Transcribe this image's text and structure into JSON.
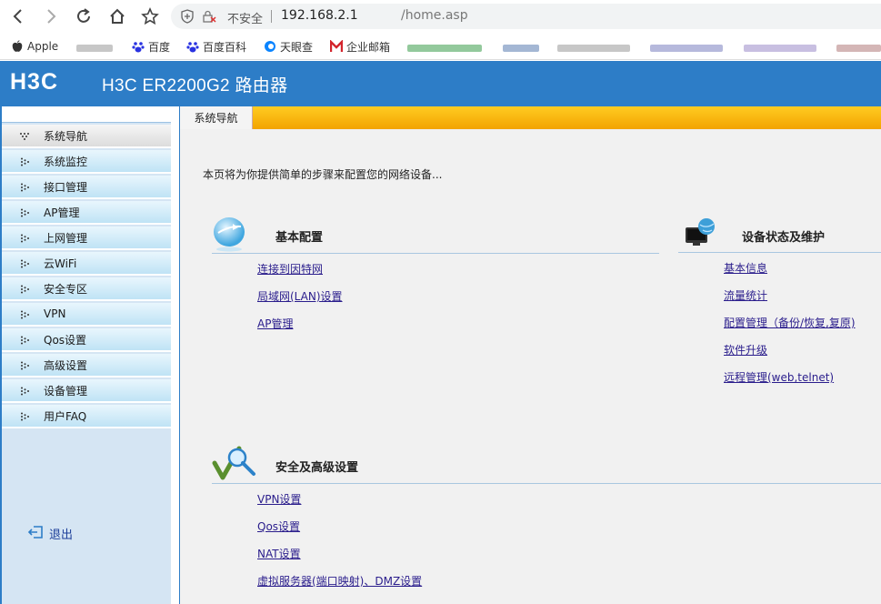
{
  "browser": {
    "security_label": "不安全",
    "url_host": "192.168.2.1",
    "url_path": "/home.asp",
    "bookmarks": [
      "Apple",
      "百度",
      "百度百科",
      "天眼查",
      "企业邮箱"
    ]
  },
  "header": {
    "logo_text": "H3C",
    "product_title": "H3C ER2200G2 路由器"
  },
  "sidebar": {
    "items": [
      {
        "label": "系统导航"
      },
      {
        "label": "系统监控"
      },
      {
        "label": "接口管理"
      },
      {
        "label": "AP管理"
      },
      {
        "label": "上网管理"
      },
      {
        "label": "云WiFi"
      },
      {
        "label": "安全专区"
      },
      {
        "label": "VPN"
      },
      {
        "label": "Qos设置"
      },
      {
        "label": "高级设置"
      },
      {
        "label": "设备管理"
      },
      {
        "label": "用户FAQ"
      }
    ],
    "logout_label": "退出"
  },
  "main": {
    "tab_label": "系统导航",
    "intro": "本页将为你提供简单的步骤来配置您的网络设备...",
    "sections": {
      "basic": {
        "title": "基本配置",
        "links": [
          "连接到因特网",
          "局域网(LAN)设置",
          "AP管理"
        ]
      },
      "status": {
        "title": "设备状态及维护",
        "links": [
          "基本信息",
          "流量统计",
          "配置管理（备份/恢复,复原)",
          "软件升级",
          "远程管理(web,telnet)"
        ]
      },
      "security": {
        "title": "安全及高级设置",
        "links": [
          "VPN设置",
          "Qos设置",
          "NAT设置",
          "虚拟服务器(端口映射)、DMZ设置"
        ]
      }
    }
  },
  "colors": {
    "header_blue": "#2d7dc7",
    "tab_orange": "#f3a300",
    "link": "#2a1d8c"
  }
}
